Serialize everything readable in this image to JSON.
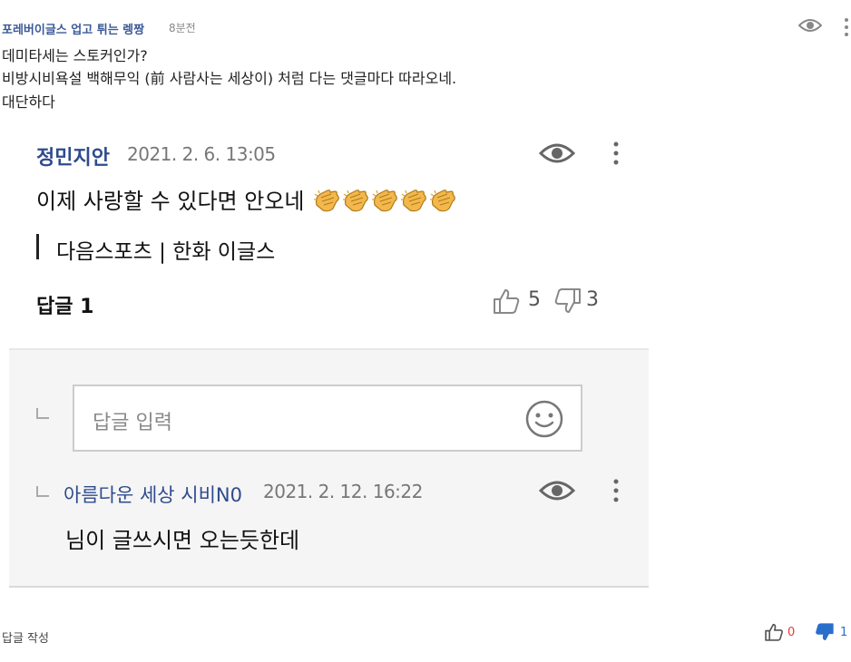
{
  "comment": {
    "author": "포레버이글스 업고 튀는 렝짱",
    "time": "8분전",
    "lines": [
      "데미타세는 스토커인가?",
      "비방시비욕설 백해무익 (前 사람사는 세상이) 처럼 다는 댓글마다 따라오네.",
      "대단하다"
    ]
  },
  "embedded": {
    "author": "정민지안",
    "time": "2021. 2. 6. 13:05",
    "text": "이제 사랑할 수 있다면 안오네",
    "emoji_icon": "clapping-hands-icon",
    "emoji_count": 5,
    "source": "다음스포츠 | 한화 이글스",
    "reply_label": "답글 1",
    "likes": "5",
    "dislikes": "3",
    "reply_input_placeholder": "답글 입력",
    "reply": {
      "author": "아름다운 세상 시비N0",
      "time": "2021. 2. 12. 16:22",
      "text": "님이 글쓰시면 오는듯한데"
    }
  },
  "footer": {
    "reply_button": "답글 작성",
    "likes": "0",
    "dislikes": "1"
  },
  "colors": {
    "author_blue": "#3b5998",
    "embedded_author_blue": "#2f4b8e",
    "like_red": "#e03a3a",
    "dislike_blue": "#2a6ecb",
    "reply_bg": "#f5f5f5"
  }
}
